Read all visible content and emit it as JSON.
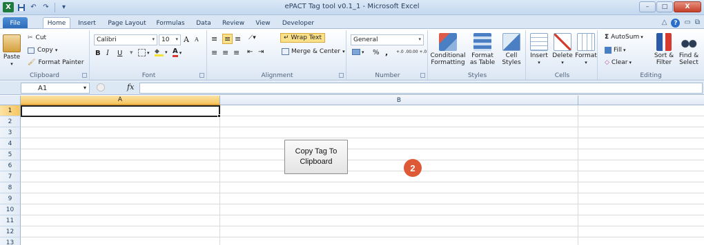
{
  "window": {
    "title": "ePACT Tag tool v0.1_1  -  Microsoft Excel",
    "app_logo": "X",
    "controls": {
      "minimize": "–",
      "maximize": "□",
      "close": "X"
    }
  },
  "tabs": [
    {
      "label": "File"
    },
    {
      "label": "Home"
    },
    {
      "label": "Insert"
    },
    {
      "label": "Page Layout"
    },
    {
      "label": "Formulas"
    },
    {
      "label": "Data"
    },
    {
      "label": "Review"
    },
    {
      "label": "View"
    },
    {
      "label": "Developer"
    }
  ],
  "active_tab": "Home",
  "ribbon": {
    "clipboard": {
      "label": "Clipboard",
      "paste": "Paste",
      "cut": "Cut",
      "copy": "Copy",
      "format_painter": "Format Painter"
    },
    "font": {
      "label": "Font",
      "font_name": "Calibri",
      "font_size": "10",
      "bold": "B",
      "italic": "I",
      "underline": "U",
      "grow": "A",
      "shrink": "A"
    },
    "alignment": {
      "label": "Alignment",
      "wrap_text": "Wrap Text",
      "merge_center": "Merge & Center"
    },
    "number": {
      "label": "Number",
      "format": "General",
      "percent": "%",
      "comma": ",",
      "inc_decimal": "+.0 .00",
      "dec_decimal": ".00 +.0"
    },
    "styles": {
      "label": "Styles",
      "conditional": [
        "Conditional",
        "Formatting"
      ],
      "format_table": [
        "Format",
        "as Table"
      ],
      "cell_styles": [
        "Cell",
        "Styles"
      ]
    },
    "cells": {
      "label": "Cells",
      "insert": "Insert",
      "delete": "Delete",
      "format": "Format"
    },
    "editing": {
      "label": "Editing",
      "autosum": "AutoSum",
      "fill": "Fill",
      "clear": "Clear",
      "sort_filter": [
        "Sort &",
        "Filter"
      ],
      "find_select": [
        "Find &",
        "Select"
      ]
    }
  },
  "formula_bar": {
    "name_box": "A1",
    "fx": "fx",
    "formula": ""
  },
  "grid": {
    "columns": [
      "A",
      "B"
    ],
    "rows": [
      "1",
      "2",
      "3",
      "4",
      "5",
      "6",
      "7",
      "8",
      "9",
      "10",
      "11",
      "12",
      "13"
    ],
    "active_cell": "A1"
  },
  "sheet_button": {
    "line1": "Copy Tag To",
    "line2": "Clipboard"
  },
  "marker": {
    "label": "2",
    "color": "#de5a37"
  },
  "colors": {
    "selected_header": "#f6c560",
    "ribbon_bg": "#e6eef8",
    "file_tab": "#2c69b8"
  }
}
